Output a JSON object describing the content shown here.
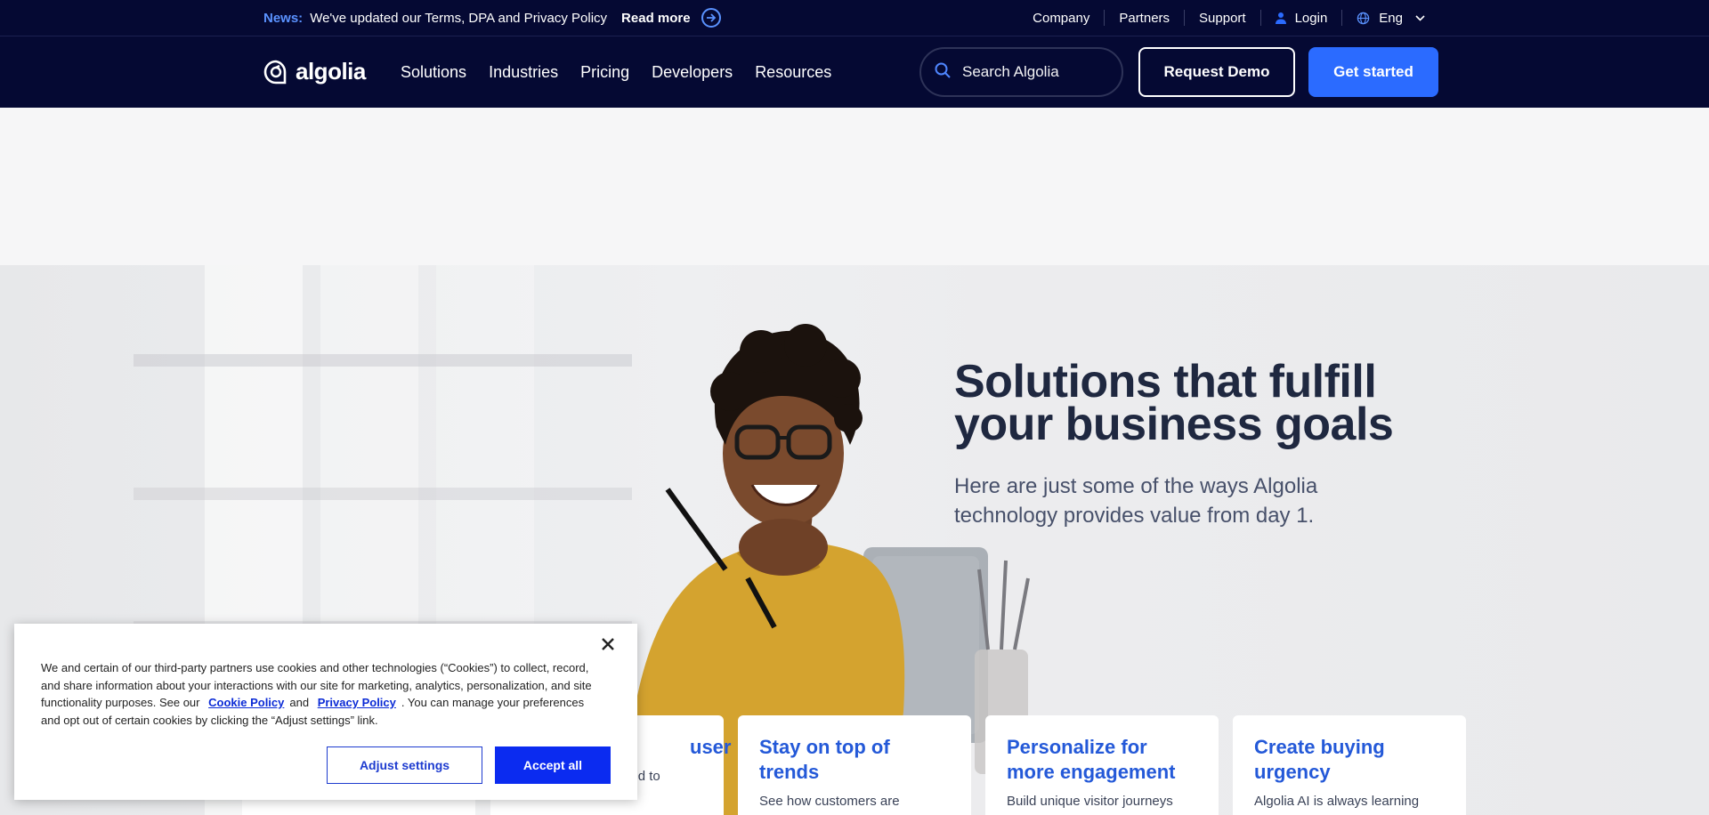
{
  "newsbar": {
    "tag": "News:",
    "text": "We've updated our Terms, DPA and Privacy Policy",
    "read_more": "Read more",
    "links": [
      "Company",
      "Partners",
      "Support"
    ],
    "login": "Login",
    "language": "Eng"
  },
  "nav": {
    "logo": "algolia",
    "items": [
      "Solutions",
      "Industries",
      "Pricing",
      "Developers",
      "Resources"
    ],
    "search_placeholder": "Search Algolia",
    "request_demo": "Request Demo",
    "get_started": "Get started"
  },
  "hero": {
    "title_line1": "Solutions that fulfill",
    "title_line2": "your business goals",
    "subtitle": "Here are just some of the ways Algolia technology provides value from day 1."
  },
  "cards": [
    {
      "title": "user",
      "desc": "AI algorithms are used to"
    },
    {
      "title": "Stay on top of trends",
      "desc": "See how customers are"
    },
    {
      "title": "Personalize for more engagement",
      "desc": "Build unique visitor journeys"
    },
    {
      "title": "Create buying urgency",
      "desc": "Algolia AI is always learning"
    }
  ],
  "cookie": {
    "text_before": "We and certain of our third-party partners use cookies and other technologies (“Cookies”) to collect, record, and share information about your interactions with our site for marketing, analytics, personalization, and site functionality purposes. See our",
    "cookie_policy": "Cookie Policy",
    "and": "and",
    "privacy_policy": "Privacy Policy",
    "text_after": ". You can manage your preferences and opt out of certain cookies by clicking the “Adjust settings” link.",
    "adjust": "Adjust settings",
    "accept": "Accept all"
  },
  "colors": {
    "nav_bg": "#050933",
    "accent": "#2b6bff",
    "card_title": "#2459d8"
  }
}
